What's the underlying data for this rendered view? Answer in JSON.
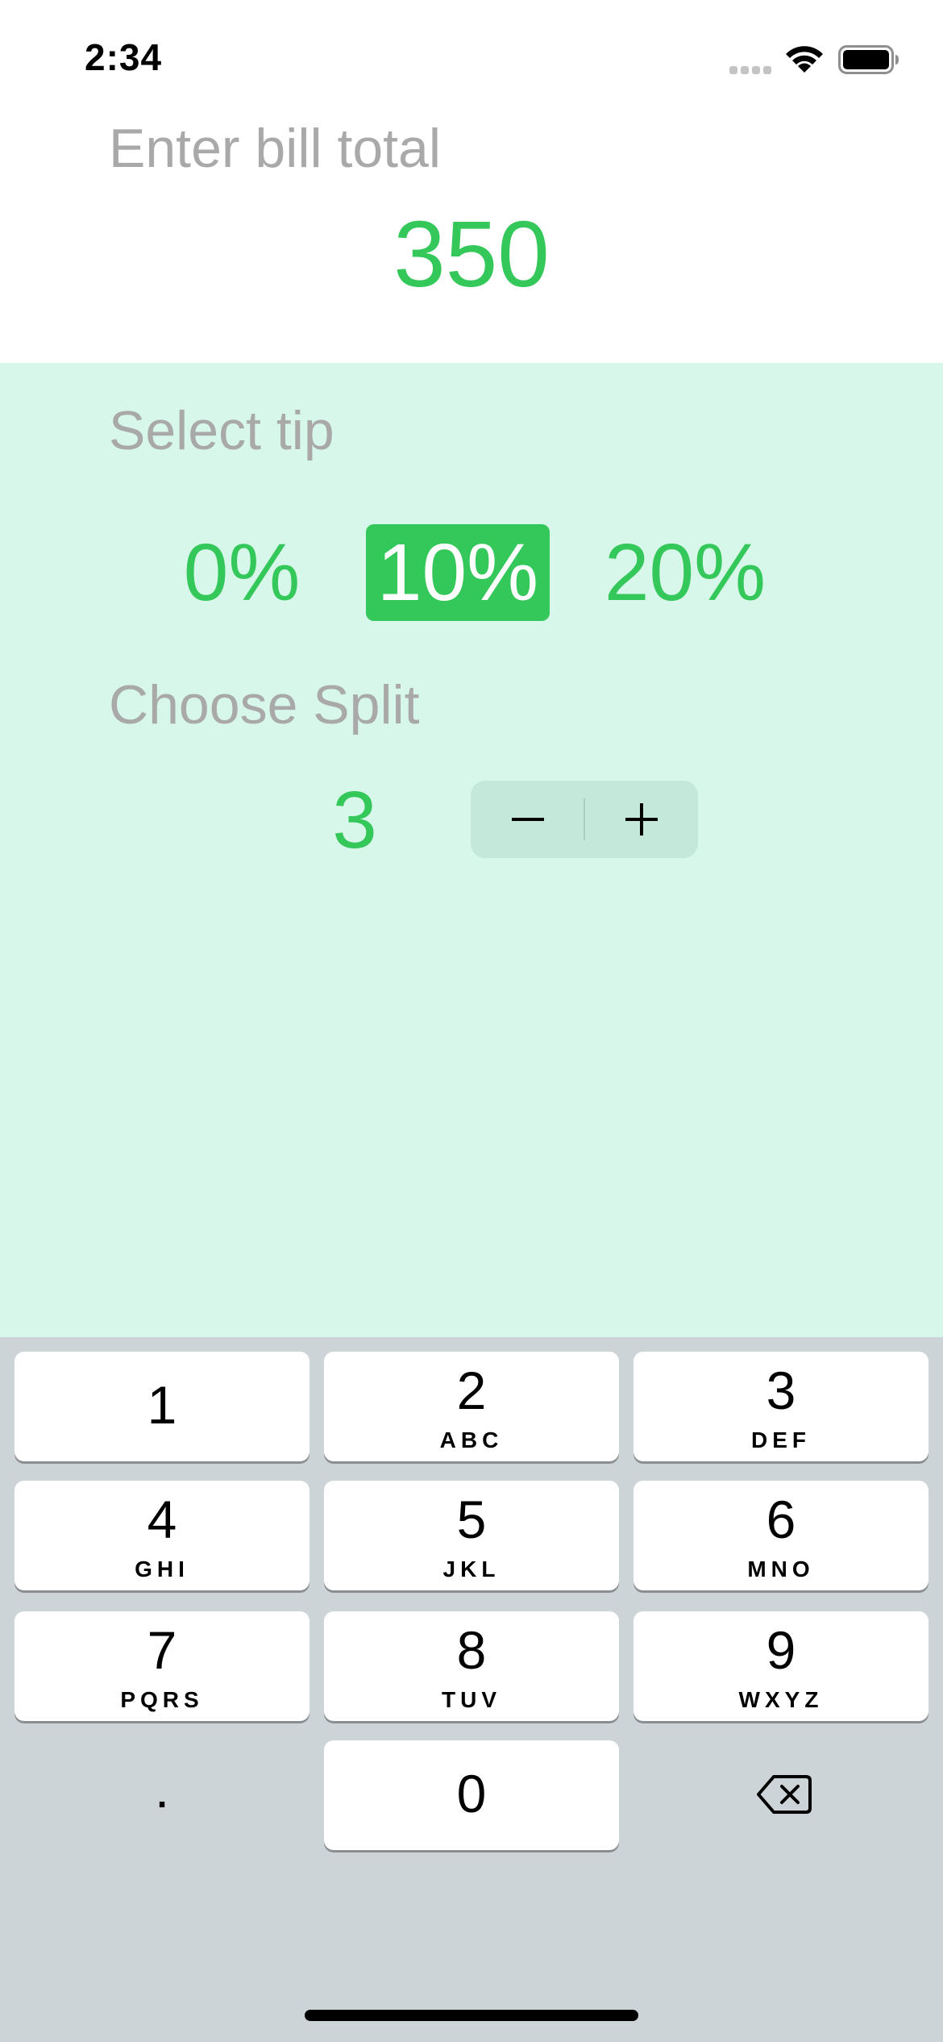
{
  "status_bar": {
    "time": "2:34"
  },
  "bill": {
    "label": "Enter bill total",
    "value": "350"
  },
  "tip": {
    "label": "Select tip",
    "options": [
      "0%",
      "10%",
      "20%"
    ],
    "selected": "10%"
  },
  "split": {
    "label": "Choose Split",
    "value": "3",
    "decrement_symbol": "−",
    "increment_symbol": "+"
  },
  "keyboard": {
    "keys": [
      {
        "digit": "1",
        "letters": ""
      },
      {
        "digit": "2",
        "letters": "ABC"
      },
      {
        "digit": "3",
        "letters": "DEF"
      },
      {
        "digit": "4",
        "letters": "GHI"
      },
      {
        "digit": "5",
        "letters": "JKL"
      },
      {
        "digit": "6",
        "letters": "MNO"
      },
      {
        "digit": "7",
        "letters": "PQRS"
      },
      {
        "digit": "8",
        "letters": "TUV"
      },
      {
        "digit": "9",
        "letters": "WXYZ"
      },
      {
        "digit": ".",
        "letters": ""
      },
      {
        "digit": "0",
        "letters": ""
      }
    ],
    "delete_icon": "backspace-icon"
  },
  "colors": {
    "accent": "#34c759",
    "label_gray": "#a9a9a9",
    "settings_background": "#d7f7ea",
    "keyboard_background": "#cdd4d8"
  }
}
